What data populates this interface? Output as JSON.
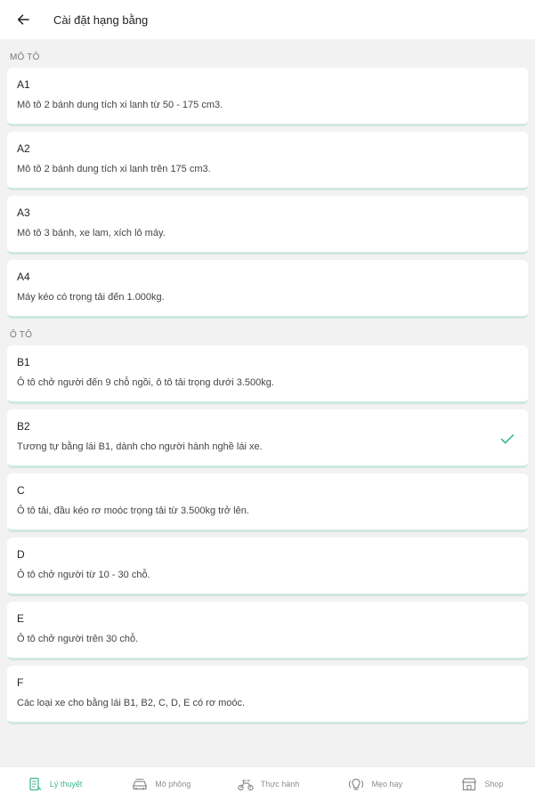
{
  "header": {
    "title": "Cài đặt hạng bằng",
    "back_icon": "arrow-left-icon"
  },
  "sections": [
    {
      "label": "MÔ TÔ",
      "items": [
        {
          "code": "A1",
          "desc": "Mô tô 2 bánh dung tích xi lanh từ 50 - 175 cm3."
        },
        {
          "code": "A2",
          "desc": "Mô tô 2 bánh dung tích xi lanh trên 175 cm3."
        },
        {
          "code": "A3",
          "desc": "Mô tô 3 bánh, xe lam, xích lô máy."
        },
        {
          "code": "A4",
          "desc": "Máy kéo có trọng tải đến 1.000kg."
        }
      ]
    },
    {
      "label": "Ô TÔ",
      "items": [
        {
          "code": "B1",
          "desc": "Ô tô chở người đến 9 chỗ ngồi, ô tô tải trọng dưới 3.500kg."
        },
        {
          "code": "B2",
          "desc": "Tương tự bằng lái B1, dành cho người hành nghề lái xe.",
          "selected": true
        },
        {
          "code": "C",
          "desc": "Ô tô tải, đầu kéo rơ moóc trọng tải từ 3.500kg trở lên."
        },
        {
          "code": "D",
          "desc": "Ô tô chở người từ 10 - 30 chỗ."
        },
        {
          "code": "E",
          "desc": "Ô tô chở người trên 30 chỗ."
        },
        {
          "code": "F",
          "desc": "Các loại xe cho bằng lái B1, B2, C, D, E có rơ moóc."
        }
      ]
    }
  ],
  "tabs": [
    {
      "label": "Lý thuyết",
      "icon": "book-icon",
      "active": true
    },
    {
      "label": "Mô phỏng",
      "icon": "car-icon"
    },
    {
      "label": "Thực hành",
      "icon": "motorbike-icon"
    },
    {
      "label": "Mẹo hay",
      "icon": "lightbulb-icon"
    },
    {
      "label": "Shop",
      "icon": "shop-icon"
    }
  ],
  "colors": {
    "accent": "#3ab88c",
    "background": "#f1f2f1",
    "card": "#ffffff",
    "card_border": "#cfe8e0"
  }
}
